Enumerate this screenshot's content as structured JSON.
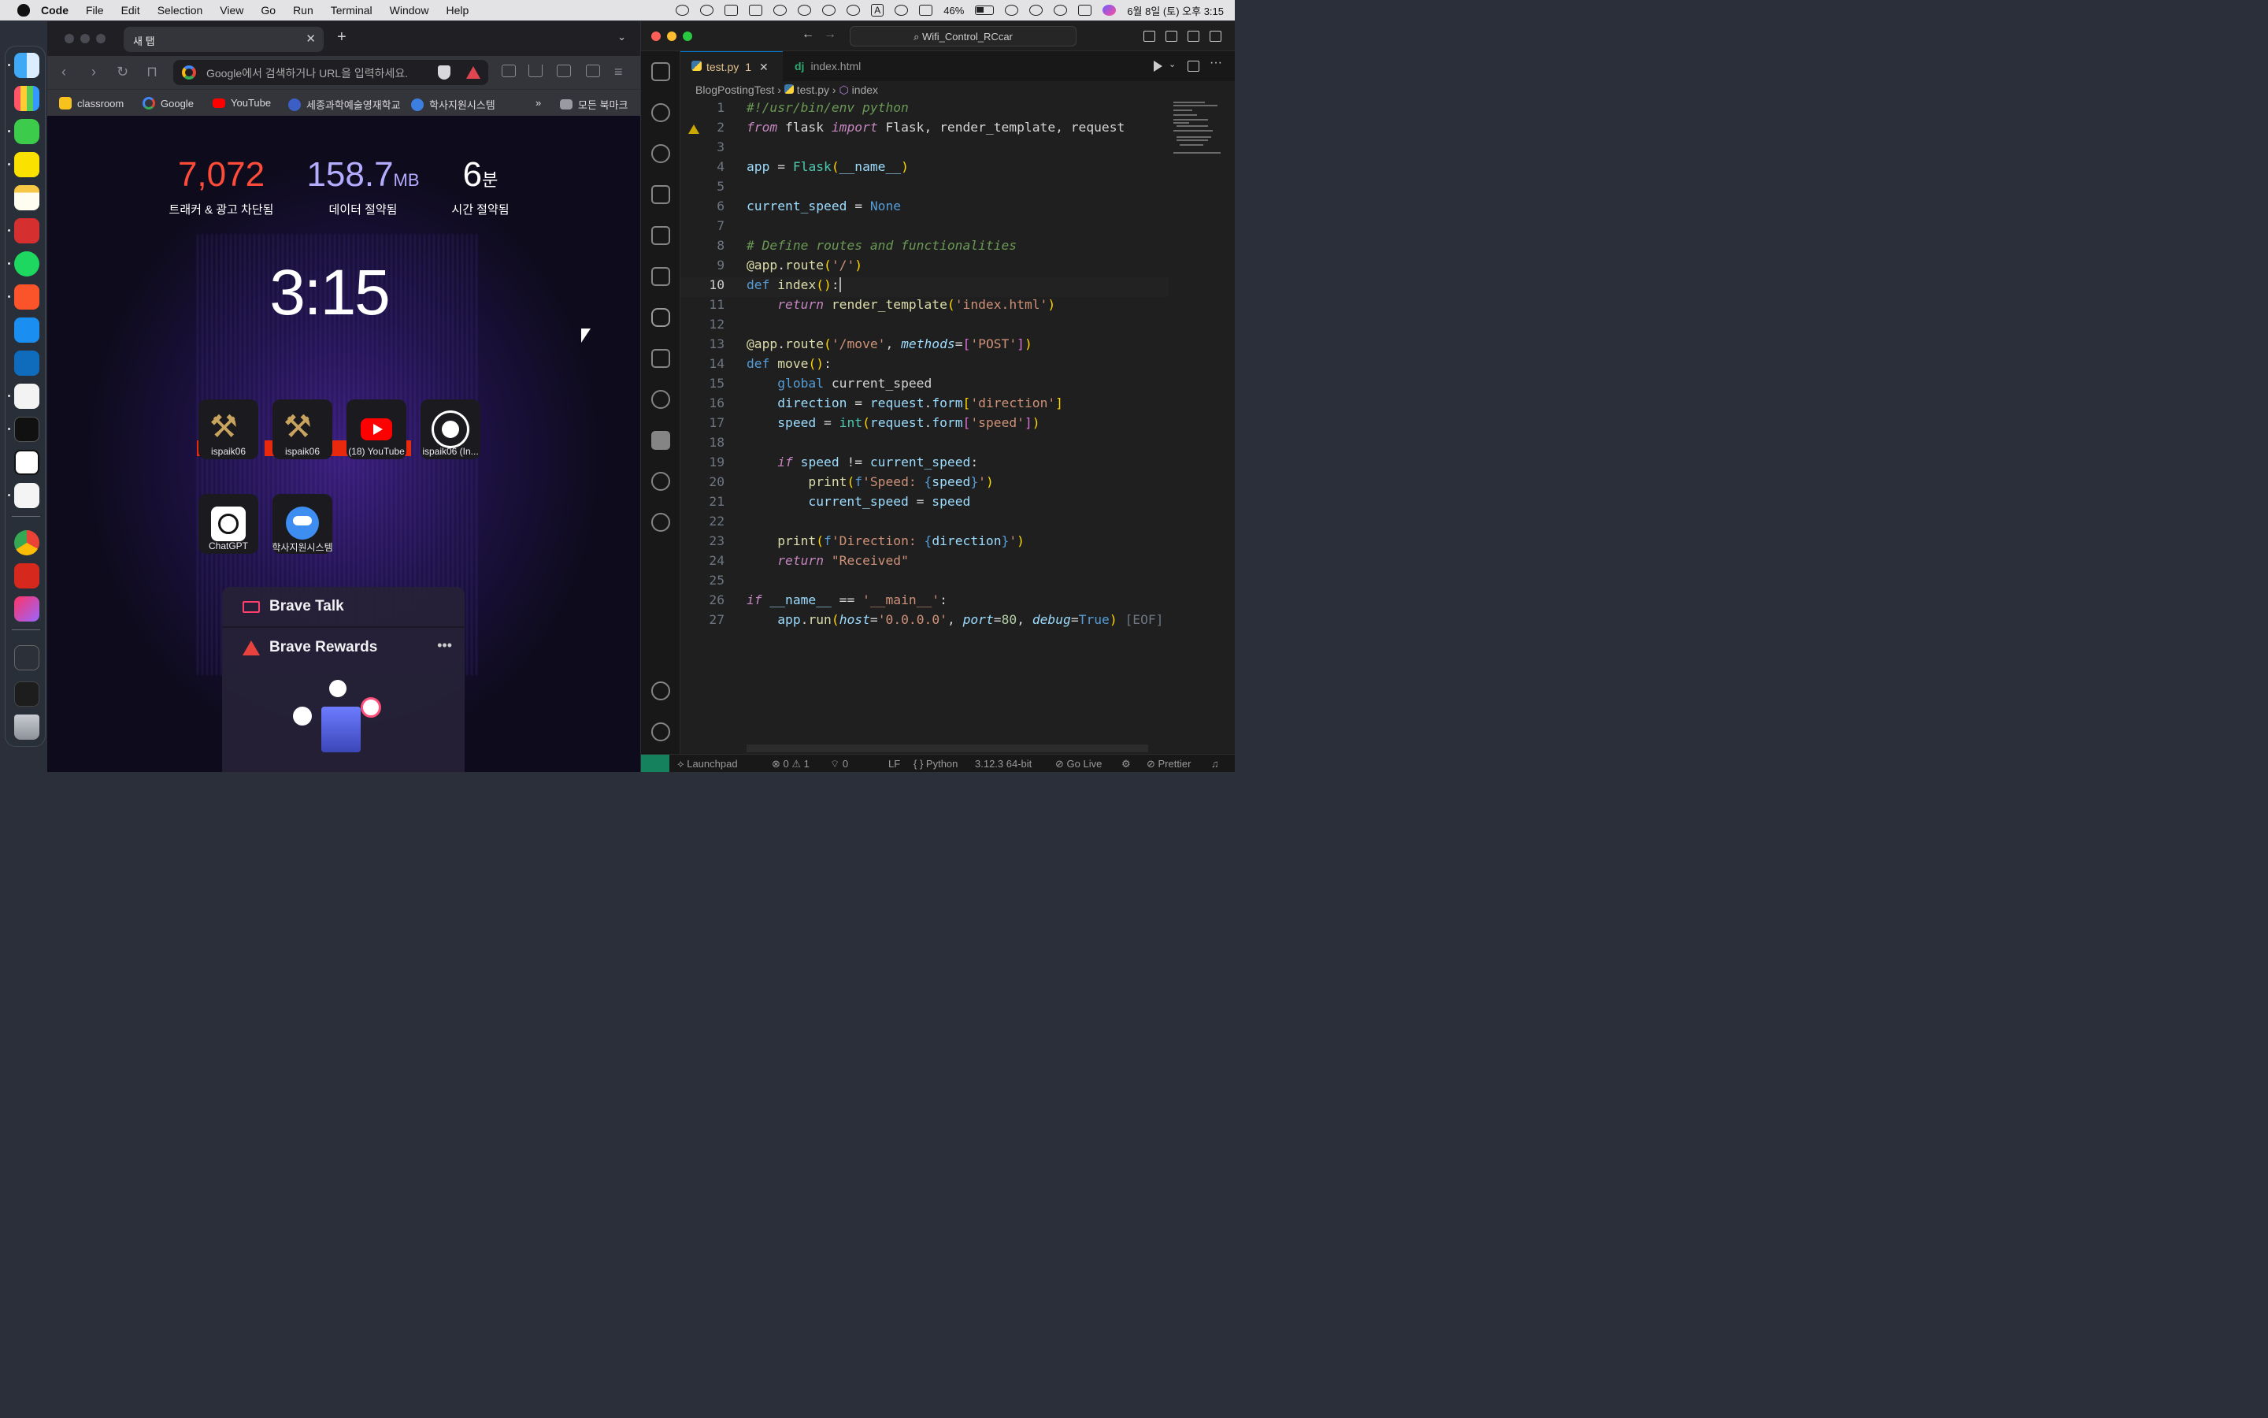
{
  "menubar": {
    "app_name": "Code",
    "items": [
      "File",
      "Edit",
      "Selection",
      "View",
      "Go",
      "Run",
      "Terminal",
      "Window",
      "Help"
    ],
    "battery": "46%",
    "datetime": "6월 8일 (토) 오후 3:15",
    "input_badge": "A"
  },
  "browser": {
    "tab_title": "새 탭",
    "tab_close": "✕",
    "new_tab": "+",
    "url_placeholder": "Google에서 검색하거나 URL을 입력하세요.",
    "bookmarks": [
      "classroom",
      "Google",
      "YouTube",
      "세종과학예술영재학교",
      "학사지원시스템"
    ],
    "bookmarks_overflow": "»",
    "all_bookmarks": "모든 북마크",
    "stats": [
      {
        "value": "7,072",
        "unit": "",
        "label": "트래커 & 광고 차단됨",
        "color": "#ff4b3a"
      },
      {
        "value": "158.7",
        "unit": "MB",
        "label": "데이터 절약됨",
        "color": "#a8a0ff"
      },
      {
        "value": "6",
        "unit": "분",
        "label": "시간 절약됨",
        "color": "#ffffff"
      }
    ],
    "clock": "3:15",
    "tiles": [
      {
        "label": "ispaik06",
        "icon": "hammer-icon"
      },
      {
        "label": "ispaik06",
        "icon": "hammer-icon"
      },
      {
        "label": "(18) YouTube",
        "icon": "youtube-icon"
      },
      {
        "label": "ispaik06 (In...",
        "icon": "github-icon"
      },
      {
        "label": "ChatGPT",
        "icon": "chatgpt-icon"
      },
      {
        "label": "학사지원시스템",
        "icon": "owl-icon"
      }
    ],
    "brave_talk": "Brave Talk",
    "brave_rewards": "Brave Rewards",
    "rewards_menu": "•••"
  },
  "vscode": {
    "search": "Wifi_Control_RCcar",
    "tabs": [
      {
        "name": "test.py",
        "badge": "1",
        "close": "✕"
      },
      {
        "name": "index.html",
        "badge": "",
        "close": ""
      }
    ],
    "breadcrumb": [
      "BlogPostingTest",
      "test.py",
      "index"
    ],
    "current_line": 10,
    "warning_line": 2,
    "statusbar": {
      "launchpad": "Launchpad",
      "errors": "0",
      "warnings": "1",
      "ports": "0",
      "eol": "LF",
      "language": "Python",
      "interpreter": "3.12.3 64-bit",
      "go_live": "Go Live",
      "prettier": "Prettier"
    }
  }
}
